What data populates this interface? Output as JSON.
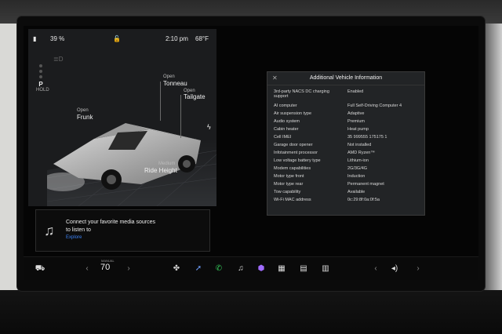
{
  "status": {
    "battery": "39 %",
    "time": "2:10 pm",
    "temperature": "68°F"
  },
  "gear": {
    "selected": "P",
    "sub": "HOLD"
  },
  "labels": {
    "tonneau_state": "Open",
    "tonneau": "Tonneau",
    "tailgate_state": "Open",
    "tailgate": "Tailgate",
    "frunk_state": "Open",
    "frunk": "Frunk",
    "ride_state": "Medium",
    "ride": "Ride Height"
  },
  "media": {
    "line1": "Connect your favorite media sources",
    "line2": "to listen to",
    "link": "Explore"
  },
  "dialog": {
    "title": "Additional Vehicle Information",
    "rows": [
      {
        "k": "3rd-party NACS DC charging support",
        "v": "Enabled"
      },
      {
        "k": "AI computer",
        "v": "Full Self-Driving Computer 4"
      },
      {
        "k": "Air suspension type",
        "v": "Adaptive"
      },
      {
        "k": "Audio system",
        "v": "Premium"
      },
      {
        "k": "Cabin heater",
        "v": "Heat pump"
      },
      {
        "k": "Cell IMEI",
        "v": "35 999555 175175 1"
      },
      {
        "k": "Garage door opener",
        "v": "Not installed"
      },
      {
        "k": "Infotainment processor",
        "v": "AMD Ryzen™"
      },
      {
        "k": "Low voltage battery type",
        "v": "Lithium-ion"
      },
      {
        "k": "Modem capabilities",
        "v": "2G/3G/4G"
      },
      {
        "k": "Motor type front",
        "v": "Induction"
      },
      {
        "k": "Motor type rear",
        "v": "Permanent magnet"
      },
      {
        "k": "Tow capability",
        "v": "Available"
      },
      {
        "k": "Wi-Fi MAC address",
        "v": "0c:29:8f:0a:0f:5a"
      }
    ]
  },
  "dock": {
    "temp_label": "MANUAL",
    "temp": "70"
  }
}
